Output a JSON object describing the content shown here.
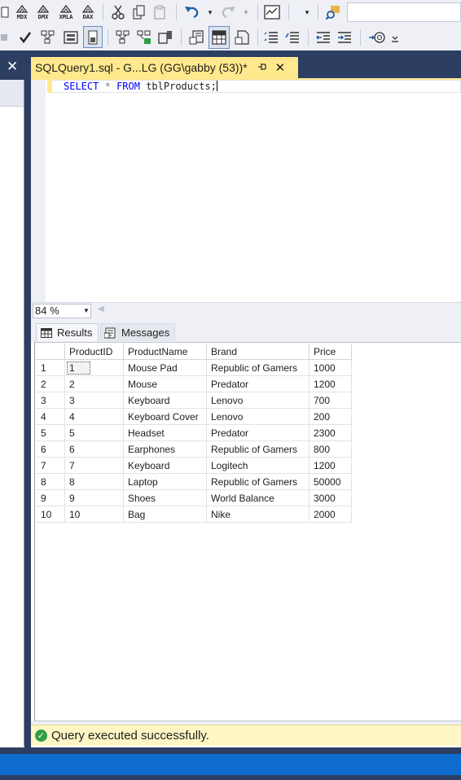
{
  "toolbar": {
    "query_type_buttons": [
      "MDX",
      "DMX",
      "XMLA",
      "DAX"
    ]
  },
  "document_tab": {
    "title": "SQLQuery1.sql - G...LG (GG\\gabby (53))*",
    "pin_glyph": "⊣",
    "close_glyph": "✕"
  },
  "left_pane": {
    "close_glyph": "✕"
  },
  "editor": {
    "kw_select": "SELECT",
    "star": "*",
    "kw_from": "FROM",
    "table": "tblProducts;"
  },
  "zoom": {
    "value": "84 %"
  },
  "results_tabs": {
    "results": "Results",
    "messages": "Messages"
  },
  "grid": {
    "columns": [
      "ProductID",
      "ProductName",
      "Brand",
      "Price"
    ],
    "rows": [
      {
        "n": "1",
        "ProductID": "1",
        "ProductName": "Mouse Pad",
        "Brand": "Republic of Gamers",
        "Price": "1000"
      },
      {
        "n": "2",
        "ProductID": "2",
        "ProductName": "Mouse",
        "Brand": "Predator",
        "Price": "1200"
      },
      {
        "n": "3",
        "ProductID": "3",
        "ProductName": "Keyboard",
        "Brand": "Lenovo",
        "Price": "700"
      },
      {
        "n": "4",
        "ProductID": "4",
        "ProductName": "Keyboard Cover",
        "Brand": "Lenovo",
        "Price": "200"
      },
      {
        "n": "5",
        "ProductID": "5",
        "ProductName": "Headset",
        "Brand": "Predator",
        "Price": "2300"
      },
      {
        "n": "6",
        "ProductID": "6",
        "ProductName": "Earphones",
        "Brand": "Republic of Gamers",
        "Price": "800"
      },
      {
        "n": "7",
        "ProductID": "7",
        "ProductName": "Keyboard",
        "Brand": "Logitech",
        "Price": "1200"
      },
      {
        "n": "8",
        "ProductID": "8",
        "ProductName": "Laptop",
        "Brand": "Republic of Gamers",
        "Price": "50000"
      },
      {
        "n": "9",
        "ProductID": "9",
        "ProductName": "Shoes",
        "Brand": "World Balance",
        "Price": "3000"
      },
      {
        "n": "10",
        "ProductID": "10",
        "ProductName": "Bag",
        "Brand": "Nike",
        "Price": "2000"
      }
    ]
  },
  "status": {
    "message": "Query executed successfully.",
    "icon": "check-circle-icon",
    "color_success": "#2f9e44"
  },
  "colors": {
    "frame": "#2c3e61",
    "tab_active": "#ffe98c",
    "statusbar": "#0e6bd0"
  }
}
